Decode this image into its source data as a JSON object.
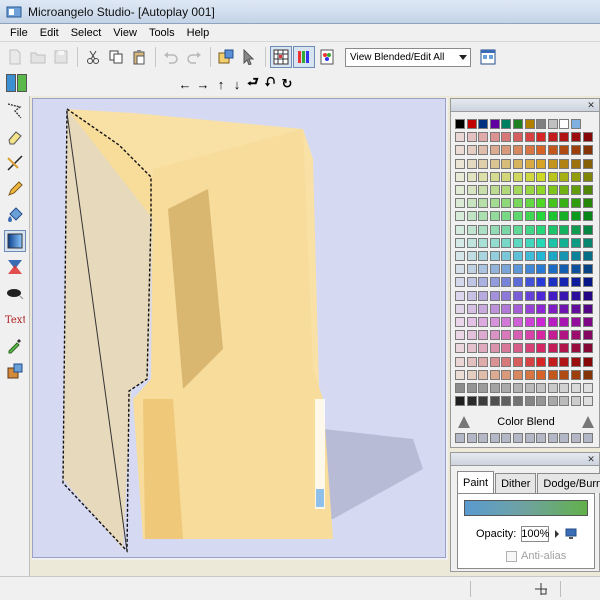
{
  "window": {
    "title": "Microangelo Studio- [Autoplay 001]"
  },
  "menu": {
    "items": [
      "File",
      "Edit",
      "Select",
      "View",
      "Tools",
      "Help"
    ]
  },
  "toolbar": {
    "view_mode": "View Blended/Edit All"
  },
  "arrows": {
    "glyphs": [
      "←",
      "→",
      "↑",
      "↓",
      "⮐",
      "⮏",
      "↻"
    ]
  },
  "colors": {
    "canvas_bg": "#d6d9f2",
    "folder_light": "#f7dc9b",
    "folder_mid": "#efc87a",
    "folder_dark": "#c9a35a",
    "shadow": "#b7bbd6",
    "primary_chip": "#3c8fd0",
    "secondary_chip": "#5bb84a"
  },
  "palette_panel": {
    "blend_label": "Color Blend"
  },
  "paint_panel": {
    "tabs": [
      "Paint",
      "Dither",
      "Dodge/Burn"
    ],
    "active_tab": "Paint",
    "opacity_label": "Opacity:",
    "opacity_value": "100%",
    "antialias_label": "Anti-alias"
  }
}
